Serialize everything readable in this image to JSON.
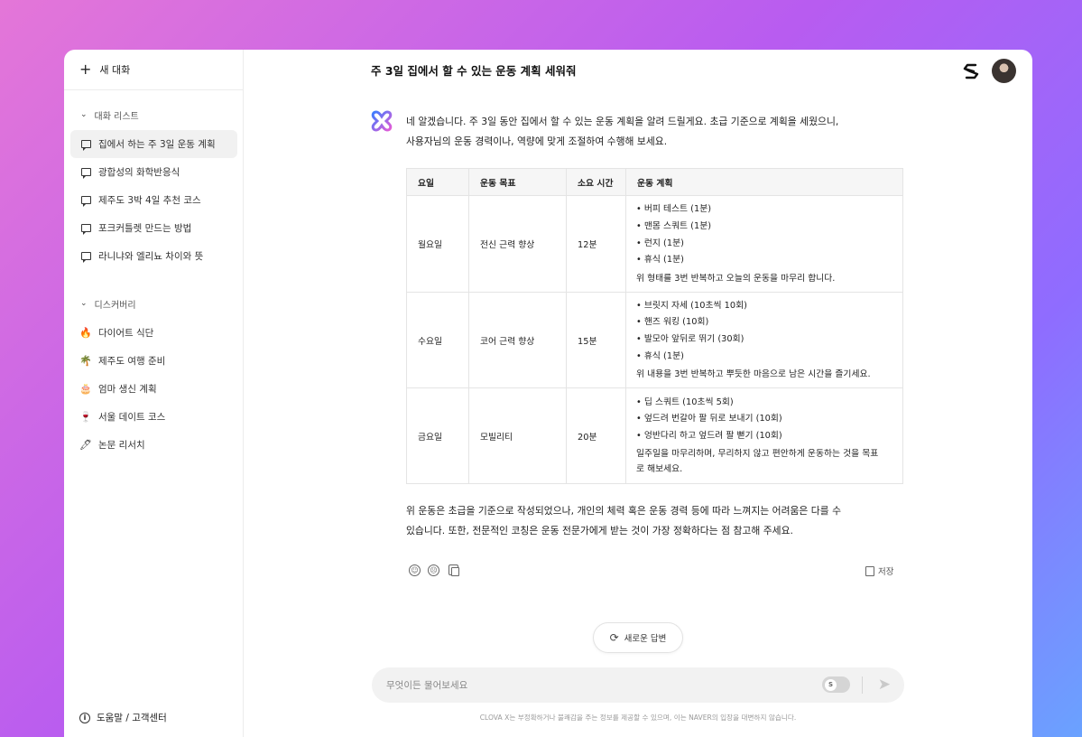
{
  "sidebar": {
    "new_chat_label": "새 대화",
    "chat_list_title": "대화 리스트",
    "chat_items": [
      {
        "label": "집에서 하는 주 3일 운동 계획"
      },
      {
        "label": "광합성의 화학반응식"
      },
      {
        "label": "제주도 3박 4일 추천 코스"
      },
      {
        "label": "포크커틀렛 만드는 방법"
      },
      {
        "label": "라니냐와 엘리뇨 차이와 뜻"
      }
    ],
    "discovery_title": "디스커버리",
    "discovery_items": [
      {
        "label": "다이어트 식단",
        "icon": "🔥",
        "icon_name": "fire-icon"
      },
      {
        "label": "제주도 여행 준비",
        "icon": "🌴",
        "icon_name": "palm-tree-icon"
      },
      {
        "label": "엄마 생신 계획",
        "icon": "🎂",
        "icon_name": "cake-icon"
      },
      {
        "label": "서울 데이트 코스",
        "icon": "🍷",
        "icon_name": "wine-icon"
      },
      {
        "label": "논문 리서치",
        "icon": "🖊",
        "icon_name": "pen-icon"
      }
    ],
    "help_label": "도움말 / 고객센터"
  },
  "header": {
    "title": "주 3일  집에서 할 수 있는 운동 계획 세워줘"
  },
  "message": {
    "intro_line1": "네 알겠습니다. 주 3일 동안 집에서 할 수 있는 운동 계획을 알려 드릴게요. 초급 기준으로 계획을 세웠으니,",
    "intro_line2": "사용자님의 운동 경력이나, 역량에 맞게 조절하여 수행해 보세요.",
    "table": {
      "headers": [
        "요일",
        "운동 목표",
        "소요 시간",
        "운동 계획"
      ],
      "rows": [
        {
          "day": "월요일",
          "goal": "전신 근력 향상",
          "time": "12분",
          "items": [
            "• 버피 테스트 (1분)",
            "• 맨몸 스쿼트 (1분)",
            "• 런지 (1분)",
            "• 휴식 (1분)"
          ],
          "note": "위 형태를 3번 반복하고 오늘의 운동을 마무리 합니다."
        },
        {
          "day": "수요일",
          "goal": "코어 근력 향상",
          "time": "15분",
          "items": [
            "• 브릿지 자세 (10초씩 10회)",
            "• 핸즈 워킹 (10회)",
            "• 발모아 앞뒤로 뛰기 (30회)",
            "• 휴식 (1분)"
          ],
          "note": "위 내용을 3번 반복하고 뿌듯한 마음으로 남은 시간을 즐기세요."
        },
        {
          "day": "금요일",
          "goal": "모빌리티",
          "time": "20분",
          "items": [
            "• 딥 스쿼트 (10초씩 5회)",
            "• 엎드려 번갈아 팔 뒤로 보내기 (10회)",
            "• 엉반다리 하고 엎드려 팔 뻗기 (10회)"
          ],
          "note": "일주일을 마무리하며, 무리하지 않고 편안하게 운동하는 것을 목표로 해보세요."
        }
      ]
    },
    "outro_line1": "위 운동은 초급을 기준으로 작성되었으나, 개인의 체력 혹은 운동 경력 등에 따라 느껴지는 어려움은 다를 수",
    "outro_line2": "있습니다. 또한, 전문적인 코칭은 운동 전문가에게 받는 것이 가장 정확하다는 점 참고해 주세요.",
    "save_label": "저장"
  },
  "regenerate_label": "새로운 답변",
  "input": {
    "placeholder": "무엇이든 물어보세요",
    "value": ""
  },
  "disclaimer": "CLOVA X는 부정확하거나 불쾌감을 주는 정보를 제공할 수 있으며, 이는 NAVER의 입장을 대변하지 않습니다.",
  "colors": {
    "bg_gradient_start": "#e476d8",
    "bg_gradient_end": "#6aa2ff",
    "logo_blue": "#3b7cff",
    "logo_pink": "#e55bd6"
  }
}
